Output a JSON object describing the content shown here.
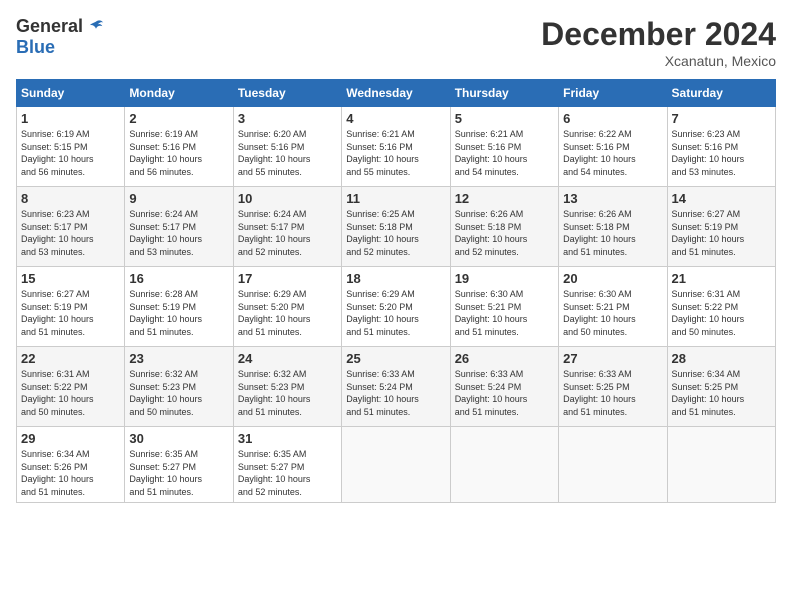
{
  "logo": {
    "general": "General",
    "blue": "Blue"
  },
  "header": {
    "month": "December 2024",
    "location": "Xcanatun, Mexico"
  },
  "weekdays": [
    "Sunday",
    "Monday",
    "Tuesday",
    "Wednesday",
    "Thursday",
    "Friday",
    "Saturday"
  ],
  "weeks": [
    [
      {
        "day": "1",
        "sunrise": "6:19 AM",
        "sunset": "5:15 PM",
        "daylight": "10 hours and 56 minutes."
      },
      {
        "day": "2",
        "sunrise": "6:19 AM",
        "sunset": "5:16 PM",
        "daylight": "10 hours and 56 minutes."
      },
      {
        "day": "3",
        "sunrise": "6:20 AM",
        "sunset": "5:16 PM",
        "daylight": "10 hours and 55 minutes."
      },
      {
        "day": "4",
        "sunrise": "6:21 AM",
        "sunset": "5:16 PM",
        "daylight": "10 hours and 55 minutes."
      },
      {
        "day": "5",
        "sunrise": "6:21 AM",
        "sunset": "5:16 PM",
        "daylight": "10 hours and 54 minutes."
      },
      {
        "day": "6",
        "sunrise": "6:22 AM",
        "sunset": "5:16 PM",
        "daylight": "10 hours and 54 minutes."
      },
      {
        "day": "7",
        "sunrise": "6:23 AM",
        "sunset": "5:16 PM",
        "daylight": "10 hours and 53 minutes."
      }
    ],
    [
      {
        "day": "8",
        "sunrise": "6:23 AM",
        "sunset": "5:17 PM",
        "daylight": "10 hours and 53 minutes."
      },
      {
        "day": "9",
        "sunrise": "6:24 AM",
        "sunset": "5:17 PM",
        "daylight": "10 hours and 53 minutes."
      },
      {
        "day": "10",
        "sunrise": "6:24 AM",
        "sunset": "5:17 PM",
        "daylight": "10 hours and 52 minutes."
      },
      {
        "day": "11",
        "sunrise": "6:25 AM",
        "sunset": "5:18 PM",
        "daylight": "10 hours and 52 minutes."
      },
      {
        "day": "12",
        "sunrise": "6:26 AM",
        "sunset": "5:18 PM",
        "daylight": "10 hours and 52 minutes."
      },
      {
        "day": "13",
        "sunrise": "6:26 AM",
        "sunset": "5:18 PM",
        "daylight": "10 hours and 51 minutes."
      },
      {
        "day": "14",
        "sunrise": "6:27 AM",
        "sunset": "5:19 PM",
        "daylight": "10 hours and 51 minutes."
      }
    ],
    [
      {
        "day": "15",
        "sunrise": "6:27 AM",
        "sunset": "5:19 PM",
        "daylight": "10 hours and 51 minutes."
      },
      {
        "day": "16",
        "sunrise": "6:28 AM",
        "sunset": "5:19 PM",
        "daylight": "10 hours and 51 minutes."
      },
      {
        "day": "17",
        "sunrise": "6:29 AM",
        "sunset": "5:20 PM",
        "daylight": "10 hours and 51 minutes."
      },
      {
        "day": "18",
        "sunrise": "6:29 AM",
        "sunset": "5:20 PM",
        "daylight": "10 hours and 51 minutes."
      },
      {
        "day": "19",
        "sunrise": "6:30 AM",
        "sunset": "5:21 PM",
        "daylight": "10 hours and 51 minutes."
      },
      {
        "day": "20",
        "sunrise": "6:30 AM",
        "sunset": "5:21 PM",
        "daylight": "10 hours and 50 minutes."
      },
      {
        "day": "21",
        "sunrise": "6:31 AM",
        "sunset": "5:22 PM",
        "daylight": "10 hours and 50 minutes."
      }
    ],
    [
      {
        "day": "22",
        "sunrise": "6:31 AM",
        "sunset": "5:22 PM",
        "daylight": "10 hours and 50 minutes."
      },
      {
        "day": "23",
        "sunrise": "6:32 AM",
        "sunset": "5:23 PM",
        "daylight": "10 hours and 50 minutes."
      },
      {
        "day": "24",
        "sunrise": "6:32 AM",
        "sunset": "5:23 PM",
        "daylight": "10 hours and 51 minutes."
      },
      {
        "day": "25",
        "sunrise": "6:33 AM",
        "sunset": "5:24 PM",
        "daylight": "10 hours and 51 minutes."
      },
      {
        "day": "26",
        "sunrise": "6:33 AM",
        "sunset": "5:24 PM",
        "daylight": "10 hours and 51 minutes."
      },
      {
        "day": "27",
        "sunrise": "6:33 AM",
        "sunset": "5:25 PM",
        "daylight": "10 hours and 51 minutes."
      },
      {
        "day": "28",
        "sunrise": "6:34 AM",
        "sunset": "5:25 PM",
        "daylight": "10 hours and 51 minutes."
      }
    ],
    [
      {
        "day": "29",
        "sunrise": "6:34 AM",
        "sunset": "5:26 PM",
        "daylight": "10 hours and 51 minutes."
      },
      {
        "day": "30",
        "sunrise": "6:35 AM",
        "sunset": "5:27 PM",
        "daylight": "10 hours and 51 minutes."
      },
      {
        "day": "31",
        "sunrise": "6:35 AM",
        "sunset": "5:27 PM",
        "daylight": "10 hours and 52 minutes."
      },
      null,
      null,
      null,
      null
    ]
  ],
  "labels": {
    "sunrise": "Sunrise:",
    "sunset": "Sunset:",
    "daylight": "Daylight:"
  }
}
